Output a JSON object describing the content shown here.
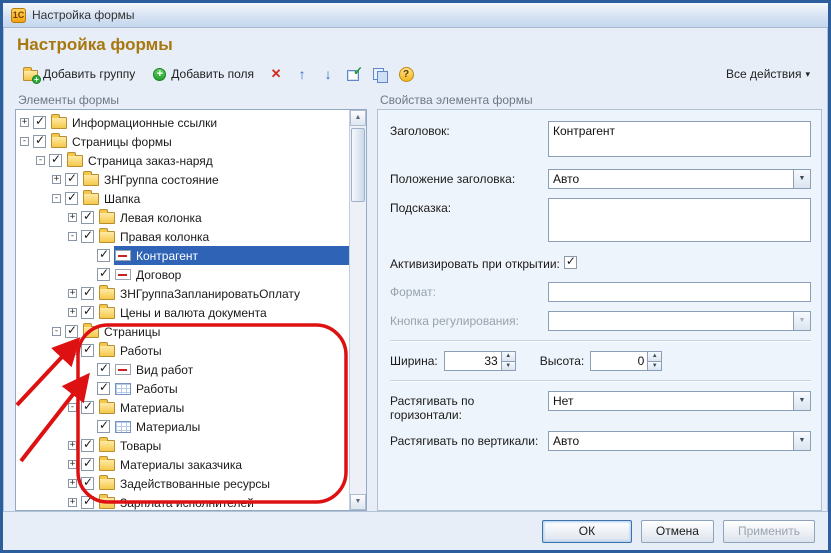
{
  "window": {
    "title": "Настройка формы",
    "app_badge": "1С"
  },
  "page": {
    "title": "Настройка формы"
  },
  "toolbar": {
    "add_group_label": "Добавить группу",
    "add_fields_label": "Добавить поля",
    "all_actions_label": "Все действия",
    "all_actions_arrow": "▾",
    "delete_glyph": "✕",
    "move_up_glyph": "↑",
    "move_down_glyph": "↓",
    "help_glyph": "?"
  },
  "tree_panel": {
    "title": "Элементы формы",
    "items": [
      {
        "label": "Информационные ссылки",
        "level": 0,
        "expander": "+",
        "checked": true,
        "icon": "folder"
      },
      {
        "label": "Страницы формы",
        "level": 0,
        "expander": "-",
        "checked": true,
        "icon": "folder"
      },
      {
        "label": "Страница заказ-наряд",
        "level": 1,
        "expander": "-",
        "checked": true,
        "icon": "folder"
      },
      {
        "label": "ЗНГруппа состояние",
        "level": 2,
        "expander": "+",
        "checked": true,
        "icon": "folder"
      },
      {
        "label": "Шапка",
        "level": 2,
        "expander": "-",
        "checked": true,
        "icon": "folder"
      },
      {
        "label": "Левая колонка",
        "level": 3,
        "expander": "+",
        "checked": true,
        "icon": "folder"
      },
      {
        "label": "Правая колонка",
        "level": 3,
        "expander": "-",
        "checked": true,
        "icon": "folder"
      },
      {
        "label": "Контрагент",
        "level": 4,
        "expander": "",
        "checked": true,
        "icon": "field",
        "selected": true
      },
      {
        "label": "Договор",
        "level": 4,
        "expander": "",
        "checked": true,
        "icon": "field"
      },
      {
        "label": "ЗНГруппаЗапланироватьОплату",
        "level": 3,
        "expander": "+",
        "checked": true,
        "icon": "folder"
      },
      {
        "label": "Цены и валюта документа",
        "level": 3,
        "expander": "+",
        "checked": true,
        "icon": "folder"
      },
      {
        "label": "Страницы",
        "level": 2,
        "expander": "-",
        "checked": true,
        "icon": "folder"
      },
      {
        "label": "Работы",
        "level": 3,
        "expander": "-",
        "checked": true,
        "icon": "folder"
      },
      {
        "label": "Вид работ",
        "level": 4,
        "expander": "",
        "checked": true,
        "icon": "field"
      },
      {
        "label": "Работы",
        "level": 4,
        "expander": "",
        "checked": true,
        "icon": "table"
      },
      {
        "label": "Материалы",
        "level": 3,
        "expander": "-",
        "checked": true,
        "icon": "folder"
      },
      {
        "label": "Материалы",
        "level": 4,
        "expander": "",
        "checked": true,
        "icon": "table"
      },
      {
        "label": "Товары",
        "level": 3,
        "expander": "+",
        "checked": true,
        "icon": "folder"
      },
      {
        "label": "Материалы заказчика",
        "level": 3,
        "expander": "+",
        "checked": true,
        "icon": "folder"
      },
      {
        "label": "Задействованные ресурсы",
        "level": 3,
        "expander": "+",
        "checked": true,
        "icon": "folder"
      },
      {
        "label": "Зарплата исполнителей",
        "level": 3,
        "expander": "+",
        "checked": true,
        "icon": "folder"
      }
    ]
  },
  "properties_panel": {
    "title": "Свойства элемента формы",
    "header": {
      "label": "Заголовок:",
      "value": "Контрагент"
    },
    "header_position": {
      "label": "Положение заголовка:",
      "value": "Авто"
    },
    "tooltip": {
      "label": "Подсказка:",
      "value": ""
    },
    "activate_on_open": {
      "label": "Активизировать при открытии:",
      "checked": true
    },
    "format": {
      "label": "Формат:",
      "value": ""
    },
    "adjust_button": {
      "label": "Кнопка регулирования:",
      "value": ""
    },
    "width": {
      "label": "Ширина:",
      "value": "33"
    },
    "height": {
      "label": "Высота:",
      "value": "0"
    },
    "stretch_horizontal": {
      "label": "Растягивать по горизонтали:",
      "value": "Нет"
    },
    "stretch_vertical": {
      "label": "Растягивать по вертикали:",
      "value": "Авто"
    }
  },
  "footer": {
    "ok": "ОК",
    "cancel": "Отмена",
    "apply": "Применить"
  },
  "colors": {
    "selection": "#2f63b5",
    "heading": "#a8780f",
    "annotation": "#dd1111"
  }
}
